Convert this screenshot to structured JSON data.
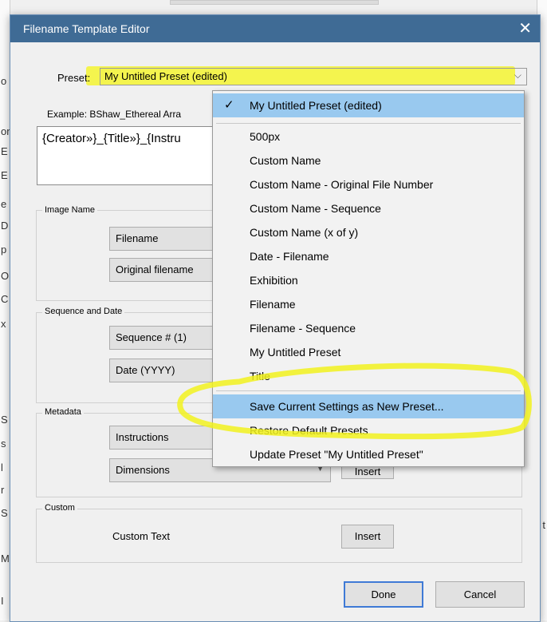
{
  "dialog": {
    "title": "Filename Template Editor",
    "close_glyph": "✕"
  },
  "preset": {
    "label": "Preset:",
    "value": "My Untitled Preset (edited)",
    "chevron": "⌵"
  },
  "example": {
    "label": "Example:",
    "value": "BShaw_Ethereal Arra"
  },
  "template": {
    "text": "{Creator»}_{Title»}_{Instru"
  },
  "image_name": {
    "title": "Image Name",
    "combo1": "Filename",
    "combo2": "Original filename"
  },
  "sequence_date": {
    "title": "Sequence and Date",
    "combo1": "Sequence # (1)",
    "combo2": "Date (YYYY)"
  },
  "metadata": {
    "title": "Metadata",
    "combo1": "Instructions",
    "combo2": "Dimensions",
    "insert_label": "Insert"
  },
  "custom": {
    "title": "Custom",
    "label": "Custom Text",
    "insert_label": "Insert"
  },
  "footer": {
    "done": "Done",
    "cancel": "Cancel"
  },
  "menu": {
    "check": "✓",
    "items": [
      "My Untitled Preset (edited)",
      "500px",
      "Custom Name",
      "Custom Name - Original File Number",
      "Custom Name - Sequence",
      "Custom Name (x of y)",
      "Date - Filename",
      "Exhibition",
      "Filename",
      "Filename - Sequence",
      "My Untitled Preset",
      "Title",
      "Save Current Settings as New Preset...",
      "Restore Default Presets",
      "Update Preset \"My Untitled Preset\""
    ]
  },
  "background": {
    "left_chars": [
      "o",
      "on",
      "E",
      "E",
      "e",
      "D",
      "p",
      "O",
      "C",
      "x",
      "S",
      "s",
      "l",
      "r",
      "S",
      "Ma",
      "I"
    ],
    "right_chars": [
      "t"
    ]
  },
  "colors": {
    "titlebar": "#3f6b95",
    "highlight_marker": "#f5f531",
    "menu_selection": "#99c9ef"
  }
}
